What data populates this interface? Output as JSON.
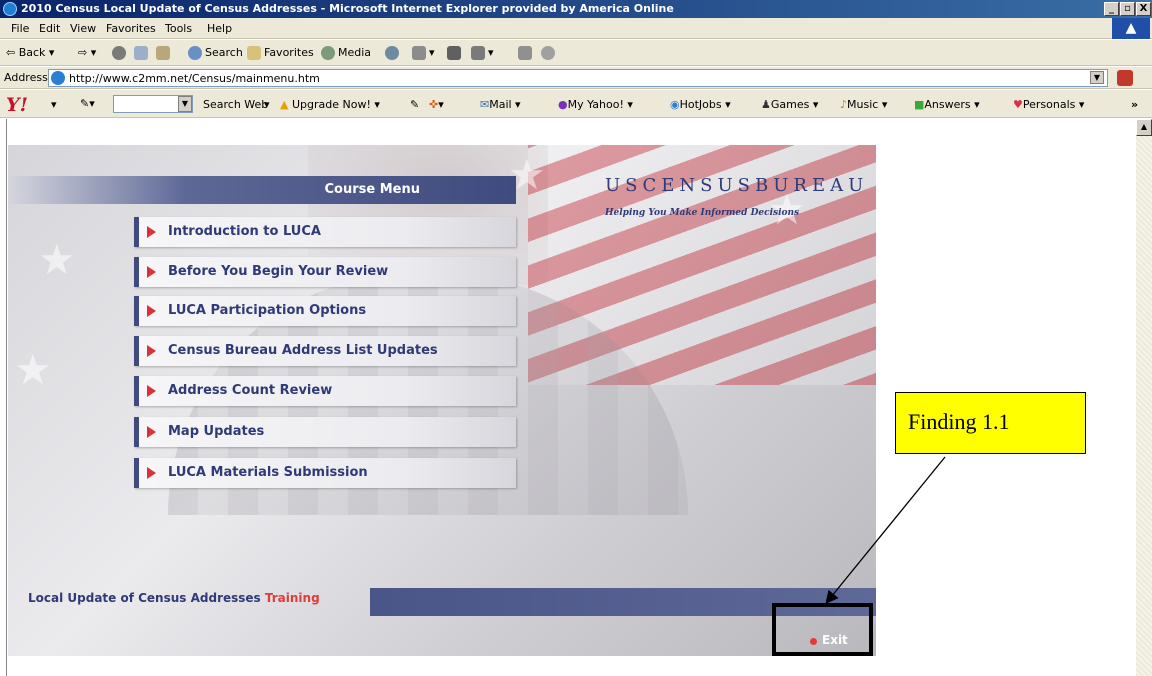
{
  "window": {
    "title": "2010 Census Local Update of Census Addresses - Microsoft Internet Explorer provided by America Online",
    "minimize": "_",
    "maximize": "▫",
    "close": "X"
  },
  "menubar": {
    "items": [
      "File",
      "Edit",
      "View",
      "Favorites",
      "Tools",
      "Help"
    ]
  },
  "toolbar": {
    "back": "Back",
    "search": "Search",
    "favorites": "Favorites",
    "media": "Media"
  },
  "addressbar": {
    "label": "Address",
    "url": "http://www.c2mm.net/Census/mainmenu.htm"
  },
  "yahoobar": {
    "logo": "Y!",
    "search_web": "Search Web",
    "upgrade": "Upgrade Now!",
    "mail": "Mail",
    "my_yahoo": "My Yahoo!",
    "hotjobs": "HotJobs",
    "games": "Games",
    "music": "Music",
    "answers": "Answers",
    "personals": "Personals",
    "more": "»"
  },
  "page": {
    "menu_header": "Course Menu",
    "logo": "USCENSUSBUREAU",
    "tagline": "Helping You Make Informed Decisions",
    "menu_items": [
      "Introduction to LUCA",
      "Before You Begin Your Review",
      "LUCA Participation Options",
      "Census Bureau Address List Updates",
      "Address Count Review",
      "Map Updates",
      "LUCA Materials Submission"
    ],
    "footer_title": "Local Update of Census Addresses",
    "footer_title_accent": "Training",
    "exit": "Exit"
  },
  "annotation": {
    "label": "Finding 1.1"
  }
}
